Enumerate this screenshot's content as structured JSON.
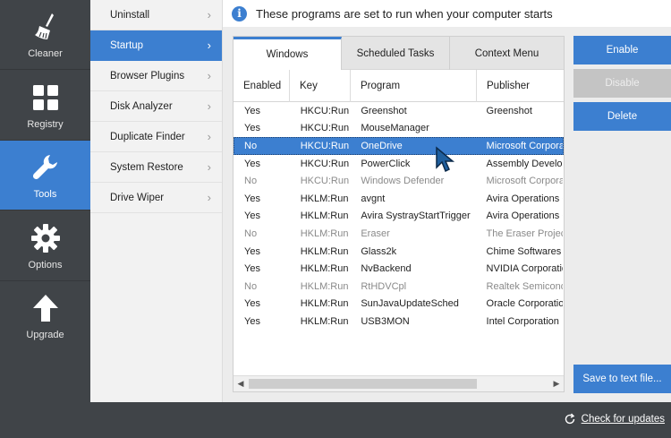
{
  "nav": {
    "items": [
      {
        "label": "Cleaner",
        "icon": "broom-icon"
      },
      {
        "label": "Registry",
        "icon": "grid-icon"
      },
      {
        "label": "Tools",
        "icon": "wrench-icon",
        "active": true
      },
      {
        "label": "Options",
        "icon": "gear-icon"
      },
      {
        "label": "Upgrade",
        "icon": "arrow-up-icon"
      }
    ]
  },
  "subnav": {
    "items": [
      {
        "label": "Uninstall"
      },
      {
        "label": "Startup",
        "active": true
      },
      {
        "label": "Browser Plugins"
      },
      {
        "label": "Disk Analyzer"
      },
      {
        "label": "Duplicate Finder"
      },
      {
        "label": "System Restore"
      },
      {
        "label": "Drive Wiper"
      }
    ]
  },
  "info": {
    "text": "These programs are set to run when your computer starts"
  },
  "tabs": [
    {
      "label": "Windows",
      "active": true
    },
    {
      "label": "Scheduled Tasks"
    },
    {
      "label": "Context Menu"
    }
  ],
  "columns": [
    "Enabled",
    "Key",
    "Program",
    "Publisher"
  ],
  "rows": [
    {
      "enabled": "Yes",
      "key": "HKCU:Run",
      "program": "Greenshot",
      "publisher": "Greenshot"
    },
    {
      "enabled": "Yes",
      "key": "HKCU:Run",
      "program": "MouseManager",
      "publisher": ""
    },
    {
      "enabled": "No",
      "key": "HKCU:Run",
      "program": "OneDrive",
      "publisher": "Microsoft Corporation",
      "selected": true
    },
    {
      "enabled": "Yes",
      "key": "HKCU:Run",
      "program": "PowerClick",
      "publisher": "Assembly Developers"
    },
    {
      "enabled": "No",
      "key": "HKCU:Run",
      "program": "Windows Defender",
      "publisher": "Microsoft Corporation"
    },
    {
      "enabled": "Yes",
      "key": "HKLM:Run",
      "program": "avgnt",
      "publisher": "Avira Operations GmbH"
    },
    {
      "enabled": "Yes",
      "key": "HKLM:Run",
      "program": "Avira SystrayStartTrigger",
      "publisher": "Avira Operations GmbH"
    },
    {
      "enabled": "No",
      "key": "HKLM:Run",
      "program": "Eraser",
      "publisher": "The Eraser Project"
    },
    {
      "enabled": "Yes",
      "key": "HKLM:Run",
      "program": "Glass2k",
      "publisher": "Chime Softwares"
    },
    {
      "enabled": "Yes",
      "key": "HKLM:Run",
      "program": "NvBackend",
      "publisher": "NVIDIA Corporation"
    },
    {
      "enabled": "No",
      "key": "HKLM:Run",
      "program": "RtHDVCpl",
      "publisher": "Realtek Semiconductor"
    },
    {
      "enabled": "Yes",
      "key": "HKLM:Run",
      "program": "SunJavaUpdateSched",
      "publisher": "Oracle Corporation"
    },
    {
      "enabled": "Yes",
      "key": "HKLM:Run",
      "program": "USB3MON",
      "publisher": "Intel Corporation"
    }
  ],
  "buttons": {
    "enable": "Enable",
    "disable": "Disable",
    "delete": "Delete",
    "save": "Save to text file..."
  },
  "footer": {
    "update_link": "Check for updates"
  },
  "colors": {
    "accent": "#3c7fd0",
    "nav_bg": "#404448",
    "disabled_button": "#c4c4c4"
  }
}
